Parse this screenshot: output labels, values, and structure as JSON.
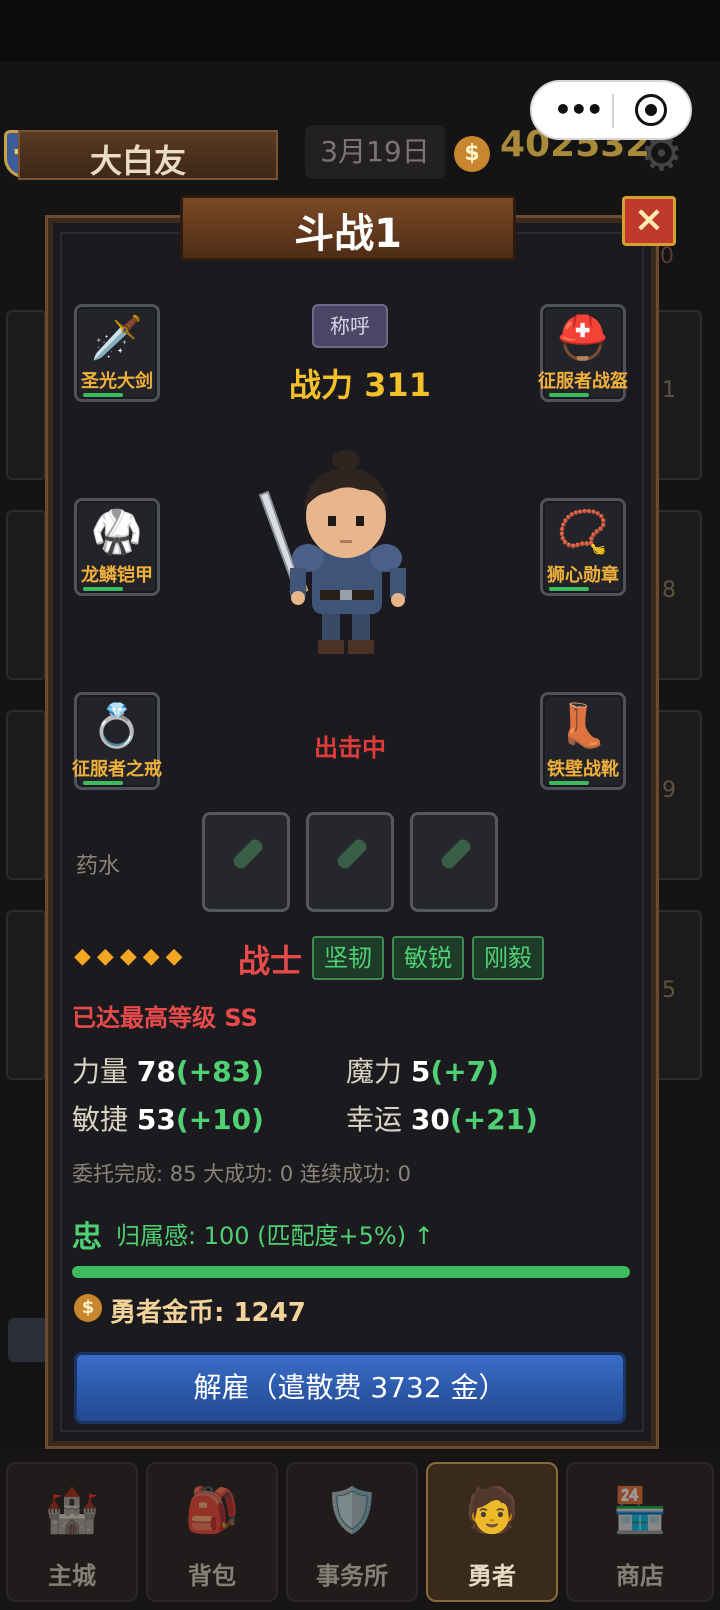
{
  "header": {
    "player_name": "大白友",
    "date": "3月19日",
    "gold": "402532"
  },
  "side_numbers": [
    "0",
    "1",
    "8",
    "9",
    "5"
  ],
  "modal": {
    "title": "斗战1",
    "close_label": "×",
    "title_chip": "称呼",
    "power": "战力 311",
    "status": "出击中",
    "equipment": {
      "left": [
        "圣光大剑",
        "龙鳞铠甲",
        "征服者之戒"
      ],
      "right": [
        "征服者战盔",
        "狮心勋章",
        "铁壁战靴"
      ]
    },
    "potion_label": "药水",
    "stars": "◆◆◆◆◆",
    "class": "战士",
    "traits": [
      "坚韧",
      "敏锐",
      "刚毅"
    ],
    "max_level": "已达最高等级 SS",
    "stats": {
      "str_label": "力量",
      "str_value": "78",
      "str_bonus": "(+83)",
      "mag_label": "魔力",
      "mag_value": "5",
      "mag_bonus": "(+7)",
      "agi_label": "敏捷",
      "agi_value": "53",
      "agi_bonus": "(+10)",
      "luck_label": "幸运",
      "luck_value": "30",
      "luck_bonus": "(+21)"
    },
    "record": "委托完成: 85  大成功: 0  连续成功: 0",
    "loyalty_icon": "忠",
    "loyalty_text": "归属感: 100 (匹配度+5%) ↑",
    "loyalty_progress": 1.0,
    "hero_gold": "勇者金币: 1247",
    "dismiss_label": "解雇（遣散费 3732 金）"
  },
  "nav": [
    "主城",
    "背包",
    "事务所",
    "勇者",
    "商店"
  ],
  "colors": {
    "accent_gold": "#f5c12a",
    "danger": "#e64a4a",
    "good": "#4fd072",
    "button_blue": "#2a56a6"
  }
}
